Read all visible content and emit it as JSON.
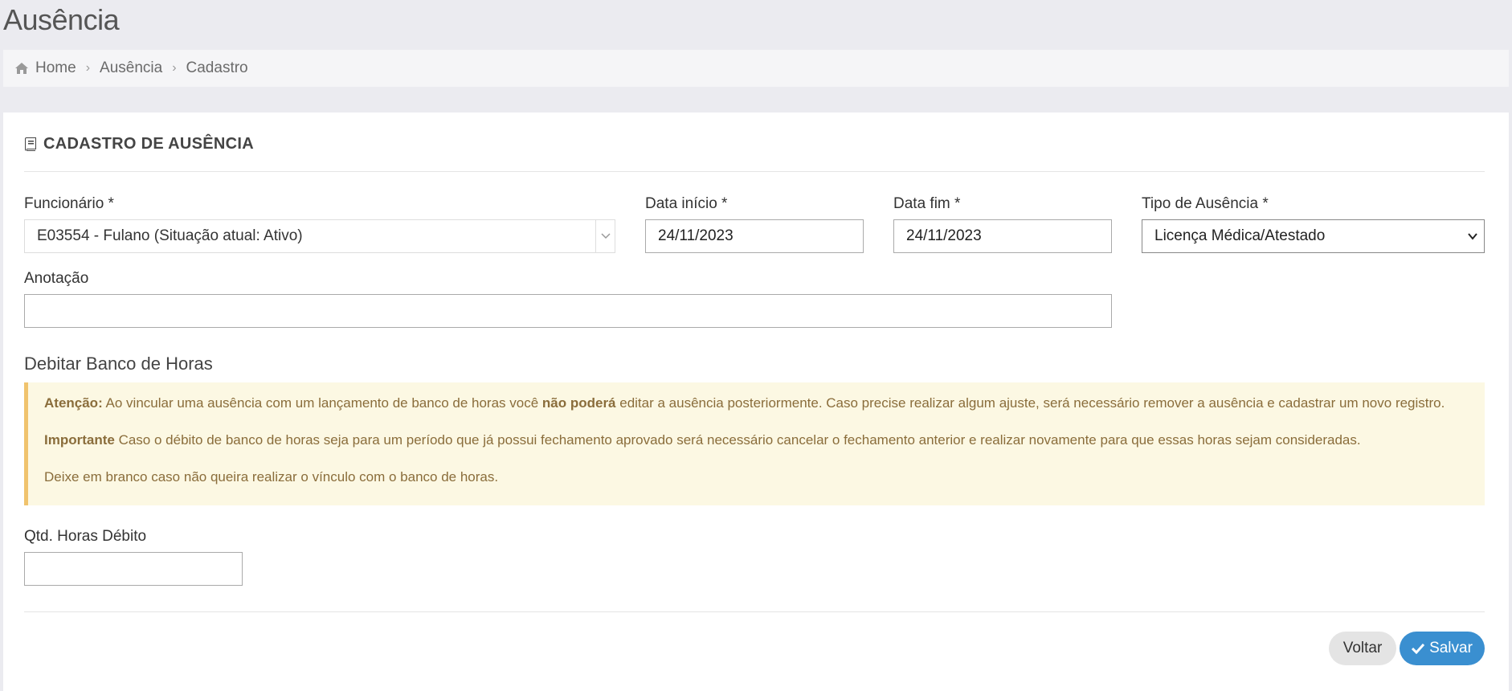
{
  "page": {
    "title": "Ausência"
  },
  "breadcrumb": {
    "items": [
      {
        "label": "Home",
        "icon": "home-icon"
      },
      {
        "label": "Ausência"
      },
      {
        "label": "Cadastro"
      }
    ]
  },
  "panel": {
    "title": "CADASTRO DE AUSÊNCIA",
    "icon": "book-icon"
  },
  "form": {
    "funcionario": {
      "label": "Funcionário *",
      "value": "E03554 - Fulano (Situação atual: Ativo)"
    },
    "data_inicio": {
      "label": "Data início *",
      "value": "24/11/2023"
    },
    "data_fim": {
      "label": "Data fim *",
      "value": "24/11/2023"
    },
    "tipo_ausencia": {
      "label": "Tipo de Ausência *",
      "value": "Licença Médica/Atestado"
    },
    "anotacao": {
      "label": "Anotação",
      "value": ""
    },
    "banco_horas": {
      "section_title": "Debitar Banco de Horas",
      "alert": {
        "p1_strong": "Atenção:",
        "p1_a": " Ao vincular uma ausência com um lançamento de banco de horas você ",
        "p1_strong2": "não poderá",
        "p1_b": " editar a ausência posteriormente. Caso precise realizar algum ajuste, será necessário remover a ausência e cadastrar um novo registro.",
        "p2_strong": "Importante",
        "p2_a": " Caso o débito de banco de horas seja para um período que já possui fechamento aprovado será necessário cancelar o fechamento anterior e realizar novamente para que essas horas sejam consideradas.",
        "p3": "Deixe em branco caso não queira realizar o vínculo com o banco de horas."
      },
      "qtd_horas": {
        "label": "Qtd. Horas Débito",
        "value": ""
      }
    }
  },
  "actions": {
    "back_label": "Voltar",
    "save_label": "Salvar"
  },
  "colors": {
    "primary": "#3a8fd0",
    "alert_bg": "#fcf8e3",
    "alert_border": "#f0c36d",
    "alert_text": "#8a6d3b"
  }
}
